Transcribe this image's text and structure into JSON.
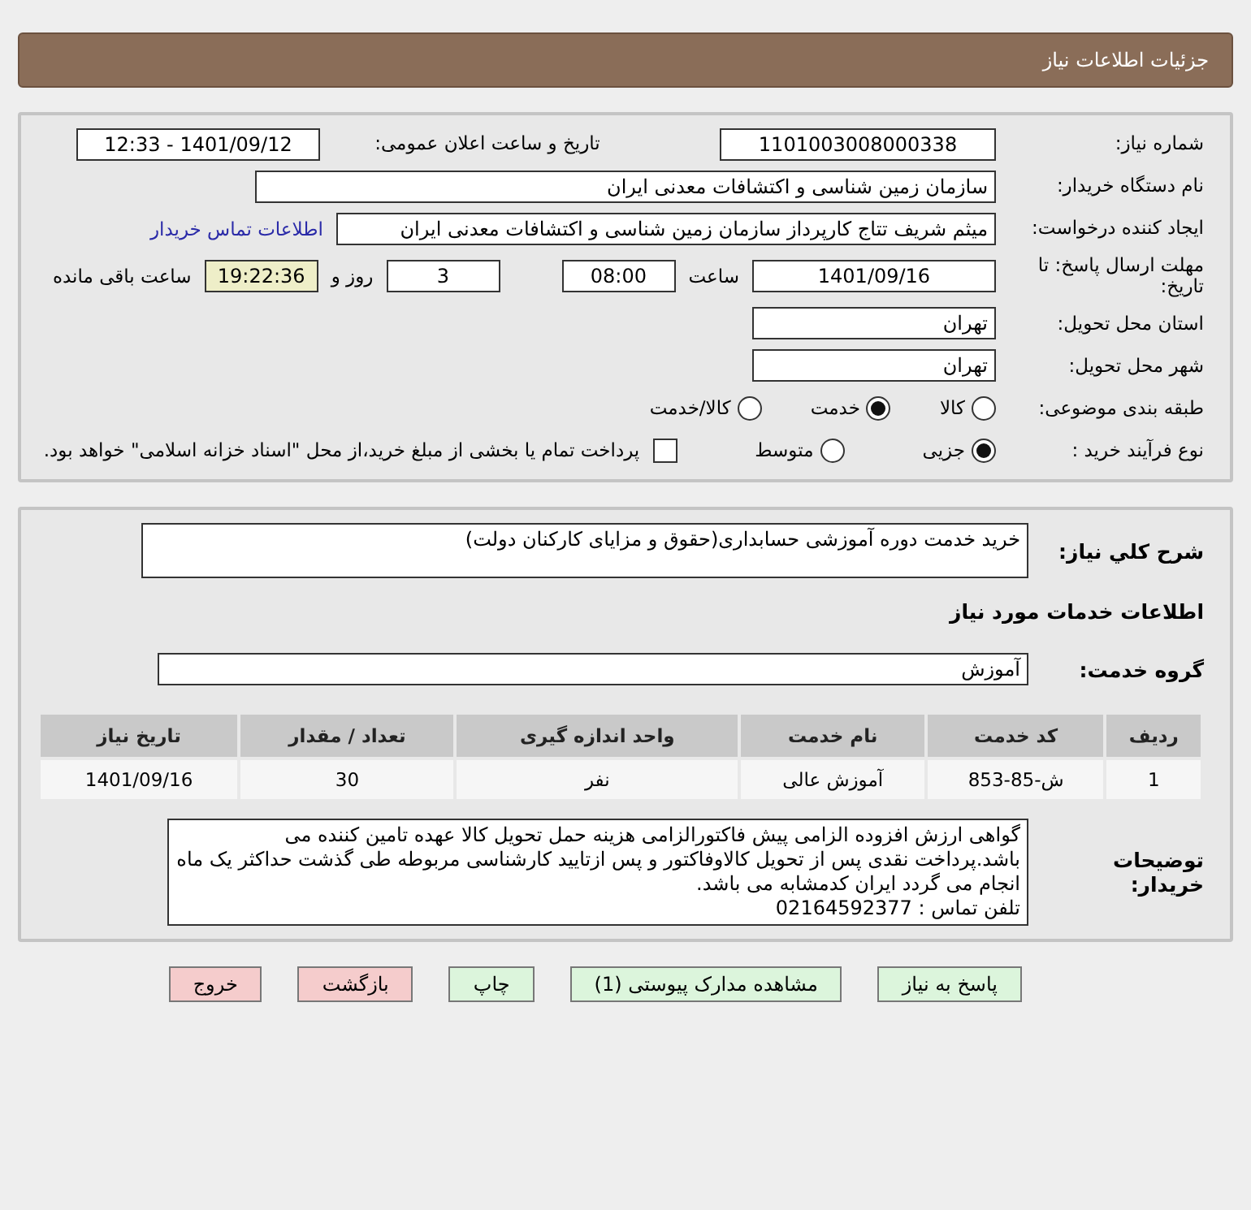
{
  "header": {
    "title": "جزئیات اطلاعات نیاز"
  },
  "need_number": {
    "label": "شماره نیاز:",
    "value": "1101003008000338"
  },
  "announce": {
    "label": "تاریخ و ساعت اعلان عمومی:",
    "value": "1401/09/12 - 12:33"
  },
  "buyer_org": {
    "label": "نام دستگاه خریدار:",
    "value": "سازمان زمین شناسی و اکتشافات معدنی ایران"
  },
  "creator": {
    "label": "ایجاد کننده درخواست:",
    "value": "میثم شریف تتاج کارپرداز سازمان زمین شناسی و اکتشافات معدنی ایران",
    "link": "اطلاعات تماس خریدار"
  },
  "deadline": {
    "label": "مهلت ارسال پاسخ: تا تاریخ:",
    "date": "1401/09/16",
    "time_label": "ساعت",
    "time": "08:00",
    "days": "3",
    "days_label": "روز و",
    "remaining": "19:22:36",
    "remaining_label": "ساعت باقی مانده"
  },
  "province": {
    "label": "استان محل تحویل:",
    "value": "تهران"
  },
  "city": {
    "label": "شهر محل تحویل:",
    "value": "تهران"
  },
  "category": {
    "label": "طبقه بندی موضوعی:",
    "options": [
      {
        "label": "کالا",
        "selected": false
      },
      {
        "label": "خدمت",
        "selected": true
      },
      {
        "label": "کالا/خدمت",
        "selected": false
      }
    ]
  },
  "process": {
    "label": "نوع فرآیند خرید :",
    "options": [
      {
        "label": "جزیی",
        "selected": true
      },
      {
        "label": "متوسط",
        "selected": false
      }
    ],
    "treasury": {
      "checked": false,
      "label": "پرداخت تمام یا بخشی از مبلغ خرید،از محل \"اسناد خزانه اسلامی\" خواهد بود."
    }
  },
  "summary": {
    "label": "شرح کلي نياز:",
    "value": "خرید خدمت دوره آموزشی حسابداری(حقوق و مزایای کارکنان دولت)"
  },
  "services_title": "اطلاعات خدمات مورد نیاز",
  "service_group": {
    "label": "گروه خدمت:",
    "value": "آموزش"
  },
  "table": {
    "columns": [
      "ردیف",
      "کد خدمت",
      "نام خدمت",
      "واحد اندازه گیری",
      "تعداد / مقدار",
      "تاریخ نیاز"
    ],
    "rows": [
      [
        "1",
        "ش-85-853",
        "آموزش عالی",
        "نفر",
        "30",
        "1401/09/16"
      ]
    ]
  },
  "buyer_notes": {
    "label": "توضیحات خریدار:",
    "paragraphs": [
      "گواهی ارزش افزوده الزامی پیش فاکتورالزامی هزینه حمل تحویل کالا عهده تامین کننده می باشد.پرداخت نقدی پس از تحویل کالاوفاکتور و پس ازتایید کارشناسی مربوطه طی گذشت حداکثر یک ماه انجام می گردد ایران کدمشابه می باشد.",
      "تلفن تماس : 02164592377"
    ]
  },
  "buttons": [
    {
      "label": "پاسخ به نیاز",
      "kind": "normal"
    },
    {
      "label": "مشاهده مدارک پیوستی (1)",
      "kind": "normal"
    },
    {
      "label": "چاپ",
      "kind": "normal"
    },
    {
      "label": "بازگشت",
      "kind": "danger"
    },
    {
      "label": "خروج",
      "kind": "danger"
    }
  ]
}
